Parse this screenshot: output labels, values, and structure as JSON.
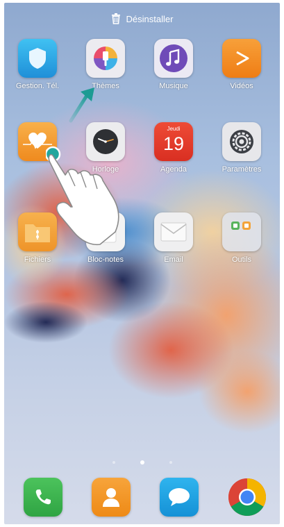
{
  "topbar": {
    "uninstall_label": "Désinstaller"
  },
  "apps": [
    {
      "label": "Gestion. Tél.",
      "icon": "shield-icon",
      "color": "#2fa9e6"
    },
    {
      "label": "Thèmes",
      "icon": "paintbrush-icon",
      "color": "#e9e6ee"
    },
    {
      "label": "Musique",
      "icon": "music-note-icon",
      "color": "#7e57c2"
    },
    {
      "label": "Vidéos",
      "icon": "play-icon",
      "color": "#f28a1c"
    },
    {
      "label": "",
      "icon": "heart-health-icon",
      "color": "#f39a24"
    },
    {
      "label": "Horloge",
      "icon": "clock-icon",
      "color": "#e6e6e8"
    },
    {
      "label": "Agenda",
      "icon": "calendar-icon",
      "color": "#e53a2b",
      "calendar": {
        "day_name": "Jeudi",
        "day_number": "19"
      }
    },
    {
      "label": "Paramètres",
      "icon": "gear-icon",
      "color": "#e4e4e7"
    },
    {
      "label": "Fichiers",
      "icon": "folder-icon",
      "color": "#f3a63a"
    },
    {
      "label": "Bloc-notes",
      "icon": "notepad-icon",
      "color": "#f2f2f2"
    },
    {
      "label": "Email",
      "icon": "envelope-icon",
      "color": "#eeeeef"
    },
    {
      "label": "Outils",
      "icon": "tools-folder-icon",
      "color": "#d8dde8"
    }
  ],
  "dock": [
    {
      "icon": "phone-icon",
      "color": "#3fb24f"
    },
    {
      "icon": "contacts-icon",
      "color": "#f2901f"
    },
    {
      "icon": "message-icon",
      "color": "#1ea1e1"
    },
    {
      "icon": "chrome-icon",
      "color": "#ffffff"
    }
  ],
  "page_indicator": {
    "count": 3,
    "active_index": 1
  }
}
